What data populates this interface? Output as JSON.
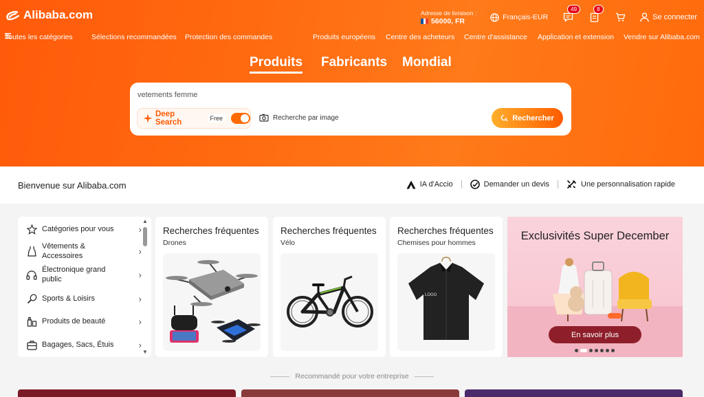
{
  "header": {
    "logo_text": "Alibaba.com",
    "delivery_label": "Adresse de livraison :",
    "delivery_value": "56000, FR",
    "language": "Français-EUR",
    "messages_badge": "49",
    "orders_badge": "8",
    "signin": "Se connecter"
  },
  "nav": {
    "all_categories": "Toutes les catégories",
    "items": [
      "Sélections recommandées",
      "Protection des commandes",
      "Produits européens",
      "Centre des acheteurs",
      "Centre d'assistance",
      "Application et extension",
      "Vendre sur Alibaba.com"
    ]
  },
  "tabs": [
    "Produits",
    "Fabricants",
    "Mondial"
  ],
  "search": {
    "query": "vetements femme",
    "deep_search": "Deep Search",
    "deep_free": "Free",
    "image_search": "Recherche par image",
    "button": "Rechercher"
  },
  "welcome": {
    "title": "Bienvenue sur Alibaba.com",
    "links": [
      "IA d'Accio",
      "Demander un devis",
      "Une personnalisation rapide"
    ]
  },
  "categories": [
    {
      "label": "Catégories pour vous",
      "icon": "star-icon"
    },
    {
      "label": "Vêtements & Accessoires",
      "icon": "dress-icon"
    },
    {
      "label": "Électronique grand public",
      "icon": "headphones-icon"
    },
    {
      "label": "Sports & Loisirs",
      "icon": "racket-icon"
    },
    {
      "label": "Produits de beauté",
      "icon": "beauty-icon"
    },
    {
      "label": "Bagages, Sacs, Étuis",
      "icon": "luggage-icon"
    }
  ],
  "cards": [
    {
      "title": "Recherches fréquentes",
      "subtitle": "Drones"
    },
    {
      "title": "Recherches fréquentes",
      "subtitle": "Vélo"
    },
    {
      "title": "Recherches fréquentes",
      "subtitle": "Chemises pour hommes"
    }
  ],
  "promo": {
    "title": "Exclusivités Super December",
    "button": "En savoir plus"
  },
  "recommended": "Recommandé pour votre entreprise",
  "colors": {
    "brand_orange": "#ff6a00",
    "promo_button": "#8e1f2a"
  }
}
